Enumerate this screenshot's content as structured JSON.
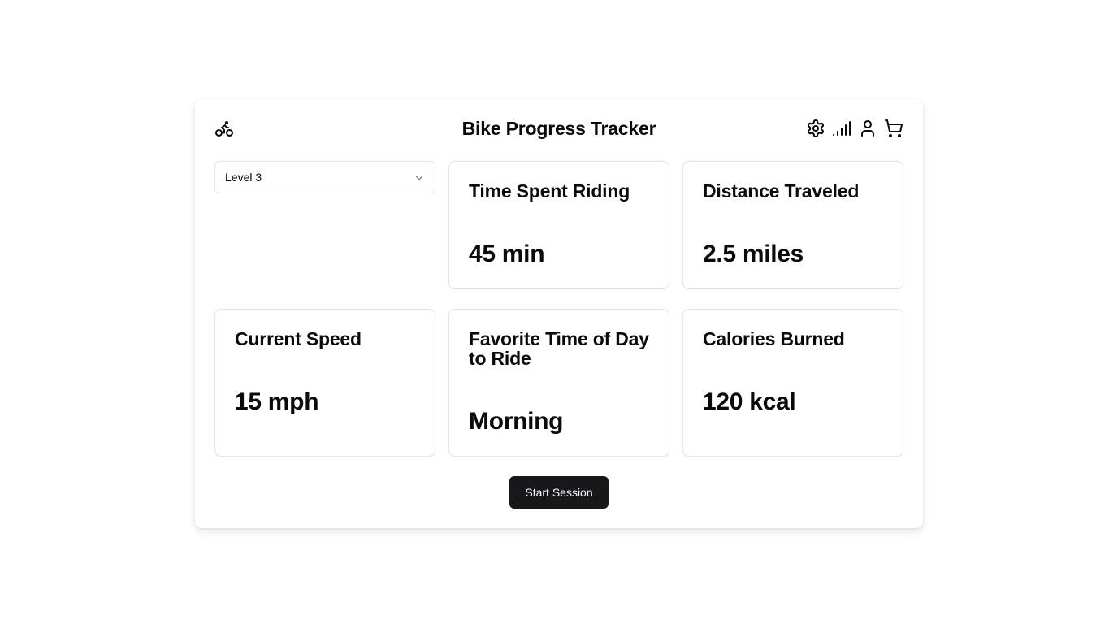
{
  "header": {
    "title": "Bike Progress Tracker",
    "logo_icon": "bike-icon",
    "icons": [
      "settings-icon",
      "signal-icon",
      "user-icon",
      "cart-icon"
    ]
  },
  "level_select": {
    "value": "Level 3"
  },
  "stats": [
    {
      "title": "Time Spent Riding",
      "value": "45 min"
    },
    {
      "title": "Distance Traveled",
      "value": "2.5 miles"
    },
    {
      "title": "Current Speed",
      "value": "15 mph"
    },
    {
      "title": "Favorite Time of Day to Ride",
      "value": "Morning"
    },
    {
      "title": "Calories Burned",
      "value": "120 kcal"
    }
  ],
  "actions": {
    "start_label": "Start Session"
  },
  "colors": {
    "primary_button": "#18181b",
    "primary_button_text": "#fafafa",
    "border": "#e4e4e7",
    "text": "#0a0a0a"
  }
}
